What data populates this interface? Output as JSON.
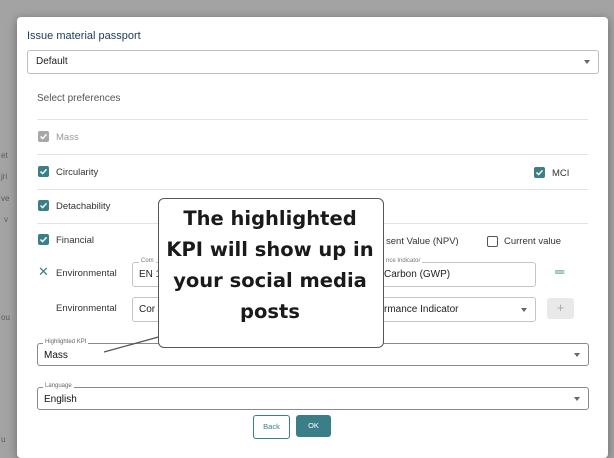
{
  "background": {
    "fragments": [
      "et",
      "jri",
      "ve",
      "v",
      "ou",
      "u"
    ]
  },
  "dialog": {
    "title": "Issue material passport",
    "template_select": {
      "value": "Default"
    },
    "preferences_title": "Select preferences",
    "preferences": {
      "mass": {
        "label": "Mass",
        "checked": true,
        "disabled": true
      },
      "circularity": {
        "label": "Circularity",
        "checked": true
      },
      "mci": {
        "label": "MCI",
        "checked": true
      },
      "detachability": {
        "label": "Detachability",
        "checked": true
      },
      "financial": {
        "label": "Financial",
        "checked": true
      },
      "npv": {
        "label": "sent Value (NPV)"
      },
      "current_value": {
        "label": "Current value",
        "checked": false
      }
    },
    "environmental_row1": {
      "label": "Environmental",
      "field1_legend": "Com",
      "field1_value": "EN 1",
      "field2_legend": "nce Indicator",
      "field2_value": "Carbon (GWP)"
    },
    "environmental_row2": {
      "label": "Environmental",
      "field1_value": "Cor",
      "field2_value": "rmance Indicator",
      "plus": "+"
    },
    "highlighted_kpi": {
      "legend": "Highlighted KPI",
      "value": "Mass"
    },
    "language": {
      "legend": "Language",
      "value": "English"
    },
    "buttons": {
      "back": "Back",
      "ok": "OK"
    }
  },
  "tooltip": {
    "text": "The highlighted KPI will show up in your social media posts"
  },
  "colors": {
    "accent": "#3a7f87",
    "title": "#1d3a57"
  }
}
